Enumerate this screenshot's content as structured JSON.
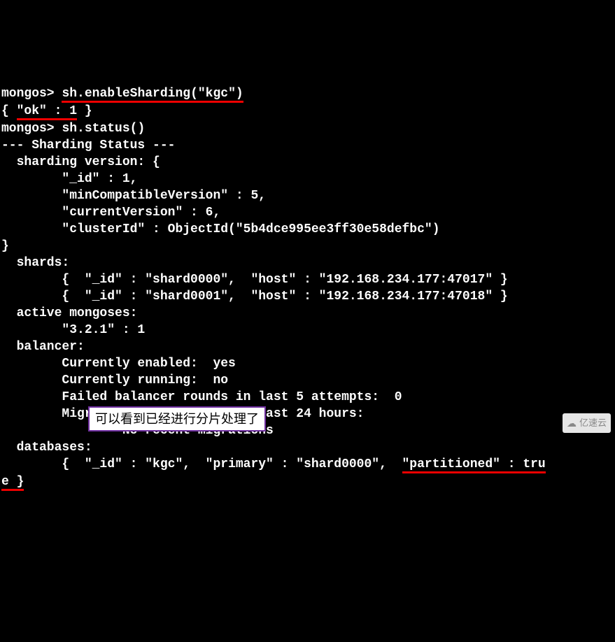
{
  "prompt": "mongos>",
  "cmd1": "sh.enableSharding(\"kgc\")",
  "result_ok_open": "{ ",
  "result_ok_mid": "\"ok\" : 1",
  "result_ok_close": " }",
  "cmd2": "sh.status()",
  "lines": {
    "l3": "--- Sharding Status --- ",
    "l4": "  sharding version: {",
    "l5": "        \"_id\" : 1,",
    "l6": "        \"minCompatibleVersion\" : 5,",
    "l7": "        \"currentVersion\" : 6,",
    "l8": "        \"clusterId\" : ObjectId(\"5b4dce995ee3ff30e58defbc\")",
    "l9": "}",
    "l10": "  shards:",
    "l11": "        {  \"_id\" : \"shard0000\",  \"host\" : \"192.168.234.177:47017\" }",
    "l12": "        {  \"_id\" : \"shard0001\",  \"host\" : \"192.168.234.177:47018\" }",
    "l13": "  active mongoses:",
    "l14": "        \"3.2.1\" : 1",
    "l15": "  balancer:",
    "l16": "        Currently enabled:  yes",
    "l17": "        Currently running:  no",
    "l18": "        Failed balancer rounds in last 5 attempts:  0",
    "l19": "        Migration Results for the last 24 hours: ",
    "l20": "                No recent migrations",
    "l21": "  databases:",
    "db_line_a": "        {  \"_id\" : \"kgc\",  \"primary\" : \"shard0000\",  ",
    "db_line_b": "\"partitioned\" : tru",
    "db_line_c": "e }"
  },
  "annotation": "可以看到已经进行分片处理了",
  "watermark": "亿速云"
}
